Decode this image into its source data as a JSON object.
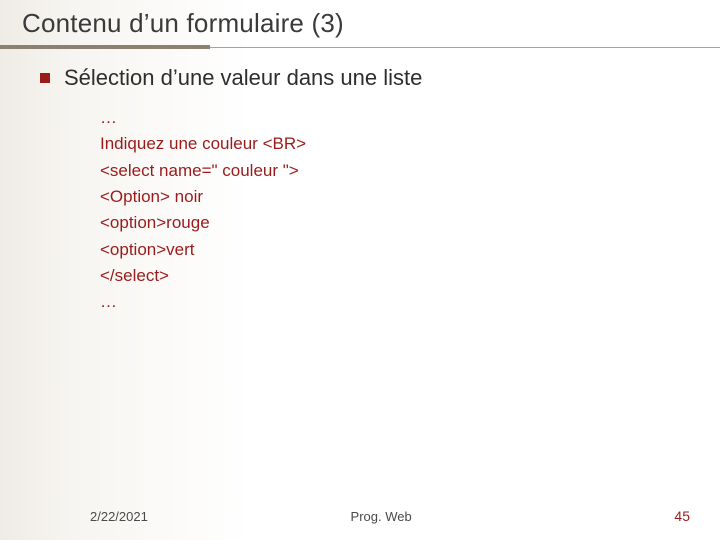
{
  "title": "Contenu d’un formulaire (3)",
  "bullet": "Sélection d’une valeur dans une liste",
  "code_lines": [
    "…",
    "Indiquez une couleur <BR>",
    "<select name=\" couleur \">",
    "<Option> noir",
    "<option>rouge",
    "<option>vert",
    "</select>",
    "…"
  ],
  "footer": {
    "date": "2/22/2021",
    "course": "Prog. Web",
    "page": "45"
  },
  "colors": {
    "accent": "#9b1b1b",
    "rule": "#8c8070"
  }
}
